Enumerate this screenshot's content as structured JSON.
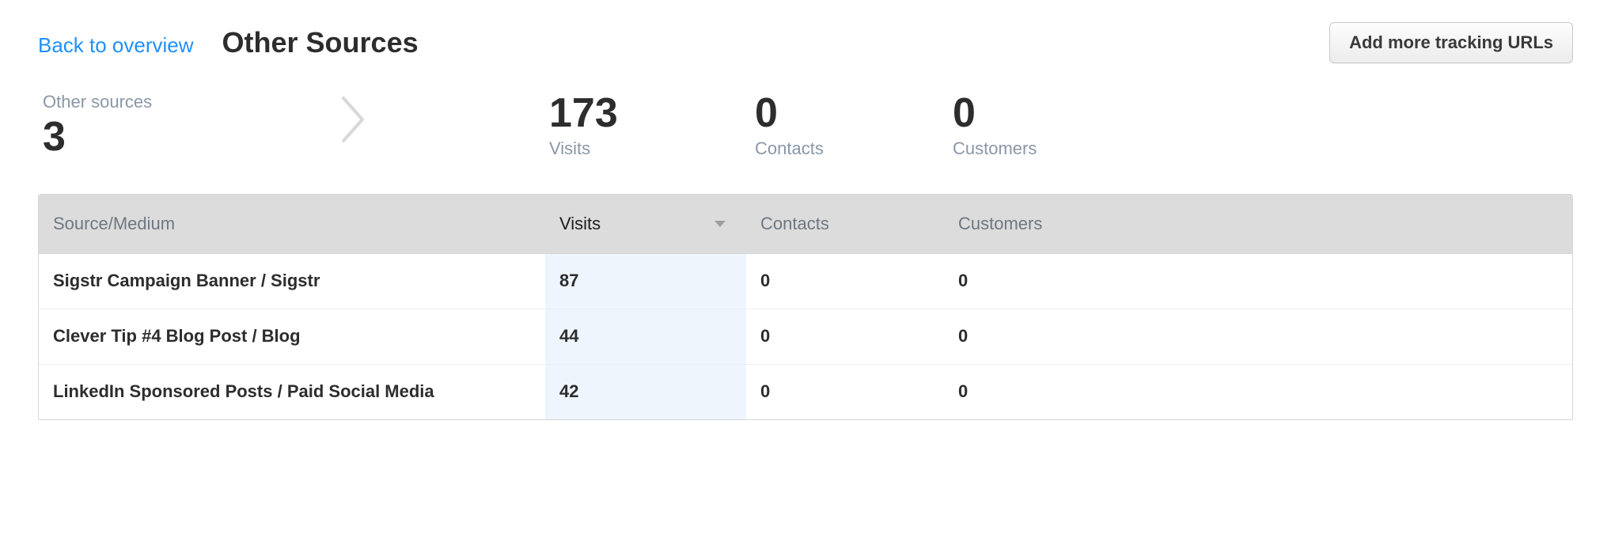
{
  "header": {
    "back_link": "Back to overview",
    "title": "Other Sources",
    "add_button": "Add more tracking URLs"
  },
  "summary": {
    "sources": {
      "label": "Other sources",
      "value": "3"
    },
    "visits": {
      "label": "Visits",
      "value": "173"
    },
    "contacts": {
      "label": "Contacts",
      "value": "0"
    },
    "customers": {
      "label": "Customers",
      "value": "0"
    }
  },
  "table": {
    "columns": {
      "source": "Source/Medium",
      "visits": "Visits",
      "contacts": "Contacts",
      "customers": "Customers"
    },
    "sort": {
      "column": "visits",
      "dir": "desc"
    },
    "rows": [
      {
        "source": "Sigstr Campaign Banner / Sigstr",
        "visits": "87",
        "contacts": "0",
        "customers": "0"
      },
      {
        "source": "Clever Tip #4 Blog Post / Blog",
        "visits": "44",
        "contacts": "0",
        "customers": "0"
      },
      {
        "source": "LinkedIn Sponsored Posts / Paid Social Media",
        "visits": "42",
        "contacts": "0",
        "customers": "0"
      }
    ]
  }
}
